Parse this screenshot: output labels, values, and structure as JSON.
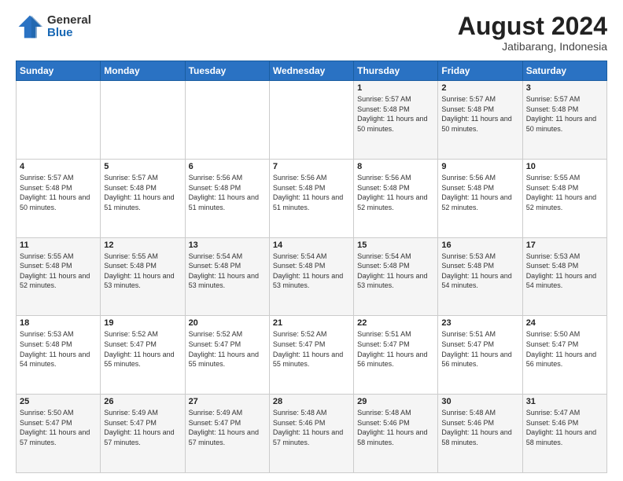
{
  "header": {
    "logo_general": "General",
    "logo_blue": "Blue",
    "month_year": "August 2024",
    "location": "Jatibarang, Indonesia"
  },
  "days_of_week": [
    "Sunday",
    "Monday",
    "Tuesday",
    "Wednesday",
    "Thursday",
    "Friday",
    "Saturday"
  ],
  "weeks": [
    [
      {
        "day": "",
        "info": ""
      },
      {
        "day": "",
        "info": ""
      },
      {
        "day": "",
        "info": ""
      },
      {
        "day": "",
        "info": ""
      },
      {
        "day": "1",
        "sunrise": "5:57 AM",
        "sunset": "5:48 PM",
        "daylight": "11 hours and 50 minutes."
      },
      {
        "day": "2",
        "sunrise": "5:57 AM",
        "sunset": "5:48 PM",
        "daylight": "11 hours and 50 minutes."
      },
      {
        "day": "3",
        "sunrise": "5:57 AM",
        "sunset": "5:48 PM",
        "daylight": "11 hours and 50 minutes."
      }
    ],
    [
      {
        "day": "4",
        "sunrise": "5:57 AM",
        "sunset": "5:48 PM",
        "daylight": "11 hours and 50 minutes."
      },
      {
        "day": "5",
        "sunrise": "5:57 AM",
        "sunset": "5:48 PM",
        "daylight": "11 hours and 51 minutes."
      },
      {
        "day": "6",
        "sunrise": "5:56 AM",
        "sunset": "5:48 PM",
        "daylight": "11 hours and 51 minutes."
      },
      {
        "day": "7",
        "sunrise": "5:56 AM",
        "sunset": "5:48 PM",
        "daylight": "11 hours and 51 minutes."
      },
      {
        "day": "8",
        "sunrise": "5:56 AM",
        "sunset": "5:48 PM",
        "daylight": "11 hours and 52 minutes."
      },
      {
        "day": "9",
        "sunrise": "5:56 AM",
        "sunset": "5:48 PM",
        "daylight": "11 hours and 52 minutes."
      },
      {
        "day": "10",
        "sunrise": "5:55 AM",
        "sunset": "5:48 PM",
        "daylight": "11 hours and 52 minutes."
      }
    ],
    [
      {
        "day": "11",
        "sunrise": "5:55 AM",
        "sunset": "5:48 PM",
        "daylight": "11 hours and 52 minutes."
      },
      {
        "day": "12",
        "sunrise": "5:55 AM",
        "sunset": "5:48 PM",
        "daylight": "11 hours and 53 minutes."
      },
      {
        "day": "13",
        "sunrise": "5:54 AM",
        "sunset": "5:48 PM",
        "daylight": "11 hours and 53 minutes."
      },
      {
        "day": "14",
        "sunrise": "5:54 AM",
        "sunset": "5:48 PM",
        "daylight": "11 hours and 53 minutes."
      },
      {
        "day": "15",
        "sunrise": "5:54 AM",
        "sunset": "5:48 PM",
        "daylight": "11 hours and 53 minutes."
      },
      {
        "day": "16",
        "sunrise": "5:53 AM",
        "sunset": "5:48 PM",
        "daylight": "11 hours and 54 minutes."
      },
      {
        "day": "17",
        "sunrise": "5:53 AM",
        "sunset": "5:48 PM",
        "daylight": "11 hours and 54 minutes."
      }
    ],
    [
      {
        "day": "18",
        "sunrise": "5:53 AM",
        "sunset": "5:48 PM",
        "daylight": "11 hours and 54 minutes."
      },
      {
        "day": "19",
        "sunrise": "5:52 AM",
        "sunset": "5:47 PM",
        "daylight": "11 hours and 55 minutes."
      },
      {
        "day": "20",
        "sunrise": "5:52 AM",
        "sunset": "5:47 PM",
        "daylight": "11 hours and 55 minutes."
      },
      {
        "day": "21",
        "sunrise": "5:52 AM",
        "sunset": "5:47 PM",
        "daylight": "11 hours and 55 minutes."
      },
      {
        "day": "22",
        "sunrise": "5:51 AM",
        "sunset": "5:47 PM",
        "daylight": "11 hours and 56 minutes."
      },
      {
        "day": "23",
        "sunrise": "5:51 AM",
        "sunset": "5:47 PM",
        "daylight": "11 hours and 56 minutes."
      },
      {
        "day": "24",
        "sunrise": "5:50 AM",
        "sunset": "5:47 PM",
        "daylight": "11 hours and 56 minutes."
      }
    ],
    [
      {
        "day": "25",
        "sunrise": "5:50 AM",
        "sunset": "5:47 PM",
        "daylight": "11 hours and 57 minutes."
      },
      {
        "day": "26",
        "sunrise": "5:49 AM",
        "sunset": "5:47 PM",
        "daylight": "11 hours and 57 minutes."
      },
      {
        "day": "27",
        "sunrise": "5:49 AM",
        "sunset": "5:47 PM",
        "daylight": "11 hours and 57 minutes."
      },
      {
        "day": "28",
        "sunrise": "5:48 AM",
        "sunset": "5:46 PM",
        "daylight": "11 hours and 57 minutes."
      },
      {
        "day": "29",
        "sunrise": "5:48 AM",
        "sunset": "5:46 PM",
        "daylight": "11 hours and 58 minutes."
      },
      {
        "day": "30",
        "sunrise": "5:48 AM",
        "sunset": "5:46 PM",
        "daylight": "11 hours and 58 minutes."
      },
      {
        "day": "31",
        "sunrise": "5:47 AM",
        "sunset": "5:46 PM",
        "daylight": "11 hours and 58 minutes."
      }
    ]
  ]
}
